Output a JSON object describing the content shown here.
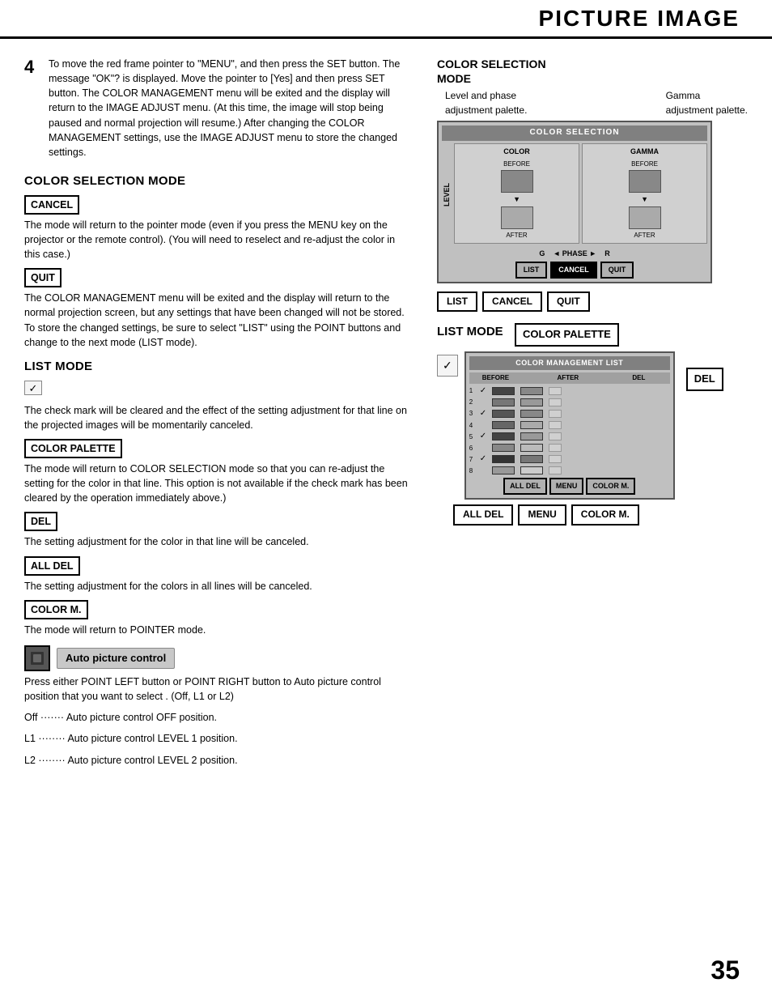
{
  "header": {
    "title": "PICTURE IMAGE"
  },
  "page_number": "35",
  "step4": {
    "number": "4",
    "text": "To move the red frame pointer to \"MENU\", and then press the SET button. The message \"OK\"? is displayed. Move the pointer to [Yes] and then press SET button. The COLOR MANAGEMENT menu will be exited and the display will return to the IMAGE ADJUST menu. (At this time, the image will stop being paused and normal projection will resume.) After changing the COLOR MANAGEMENT settings, use the IMAGE ADJUST menu to store the changed settings."
  },
  "color_selection_mode": {
    "heading": "COLOR SELECTION MODE",
    "cancel_label": "CANCEL",
    "cancel_text": "The mode will return to the pointer mode (even if you press the MENU key on the projector or the remote control). (You will need to reselect and re-adjust the color in this case.)",
    "quit_label": "QUIT",
    "quit_text": "The COLOR MANAGEMENT menu will be exited and the display will return to the normal projection screen, but any settings that have been changed will not be stored. To store the changed settings, be sure to select \"LIST\" using the POINT buttons and change to the next mode (LIST mode)."
  },
  "list_mode": {
    "heading": "LIST MODE",
    "checkmark_text": "The check mark will be cleared and the effect of the setting adjustment for that line on the projected images will be momentarily canceled.",
    "color_palette_label": "COLOR PALETTE",
    "color_palette_text": "The mode will return to COLOR SELECTION mode so that you can re-adjust the setting for the color in that line. This option is not available if the check mark has been cleared by the operation immediately above.)",
    "del_label": "DEL",
    "del_text": "The setting adjustment for the color in that line will be canceled.",
    "all_del_label": "ALL DEL",
    "all_del_text": "The setting adjustment for the colors in all lines will be canceled.",
    "color_m_label": "COLOR M.",
    "color_m_text": "The mode will return to POINTER mode."
  },
  "right_col": {
    "color_selection_mode_title": "COLOR SELECTION\nMODE",
    "level_phase_label": "Level and phase\nadjustment palette.",
    "gamma_label": "Gamma\nadjustment palette.",
    "cs_ui": {
      "header": "COLOR SELECTION",
      "col1_title": "COLOR",
      "col2_title": "GAMMA",
      "before": "BEFORE",
      "after": "AFTER",
      "level": "LEVEL",
      "phase_label": "◄ PHASE ►",
      "phase_g": "G",
      "phase_r": "R",
      "btn_list": "LIST",
      "btn_cancel": "CANCEL",
      "btn_quit": "QUIT"
    },
    "list_mode_title": "LIST MODE",
    "color_palette_badge": "COLOR PALETTE",
    "del_badge": "DEL",
    "lm_ui": {
      "header": "COLOR MANAGEMENT LIST",
      "col_before": "BEFORE",
      "col_after": "AFTER",
      "col_del": "DEL",
      "rows": 8
    },
    "btn_all_del": "ALL DEL",
    "btn_menu": "MENU",
    "btn_color_m": "COLOR M."
  },
  "auto_picture": {
    "label": "Auto picture control",
    "text1": "Press either POINT LEFT button or POINT RIGHT button to Auto picture control position that you want to select . (Off, L1 or L2)",
    "off_text": "Off ·······  Auto picture control OFF position.",
    "l1_text": "L1 ········ Auto picture control LEVEL 1 position.",
    "l2_text": "L2 ········ Auto picture control LEVEL 2 position."
  }
}
